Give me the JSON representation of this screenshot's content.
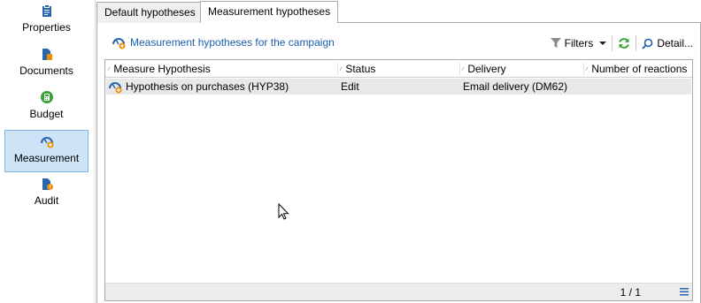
{
  "sidebar": {
    "items": [
      {
        "label": "Properties",
        "icon": "clipboard-icon"
      },
      {
        "label": "Documents",
        "icon": "documents-icon"
      },
      {
        "label": "Budget",
        "icon": "budget-icon"
      },
      {
        "label": "Measurement",
        "icon": "measurement-icon",
        "active": true
      },
      {
        "label": "Audit",
        "icon": "audit-icon"
      }
    ]
  },
  "tabs": [
    {
      "label": "Default hypotheses"
    },
    {
      "label": "Measurement hypotheses",
      "active": true
    }
  ],
  "toolbar": {
    "title": "Measurement hypotheses for the campaign",
    "filters_label": "Filters",
    "detail_label": "Detail..."
  },
  "grid": {
    "columns": [
      "Measure Hypothesis",
      "Status",
      "Delivery",
      "Number of reactions"
    ],
    "rows": [
      {
        "hypothesis": "Hypothesis on purchases (HYP38)",
        "status": "Edit",
        "delivery": "Email delivery (DM62)",
        "reactions": ""
      }
    ],
    "pager": "1 / 1"
  },
  "colors": {
    "accent": "#1c5fb0",
    "selected_nav_bg": "#cde4f7",
    "icon_blue": "#2a66b0",
    "icon_orange": "#f08c00",
    "icon_green": "#3aa33a"
  }
}
